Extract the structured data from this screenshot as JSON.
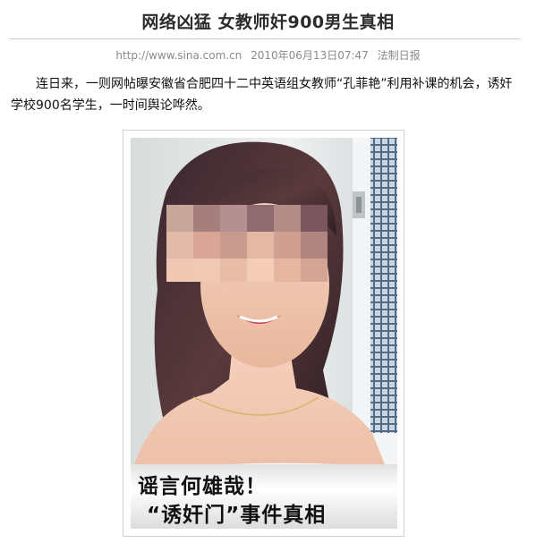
{
  "article": {
    "headline": "网络凶猛  女教师奸900男生真相",
    "source_url": "http://www.sina.com.cn",
    "date": "2010年06月13日07:47",
    "outlet": "法制日报",
    "lede": "连日来，一则网帖曝安徽省合肥四十二中英语组女教师“孔菲艳”利用补课的机会，诱奸学校900名学生，一时间舆论哗然。"
  },
  "photo": {
    "caption_line1": "谣言何雄哉！",
    "caption_line2": "“诱奸门”事件真相"
  }
}
